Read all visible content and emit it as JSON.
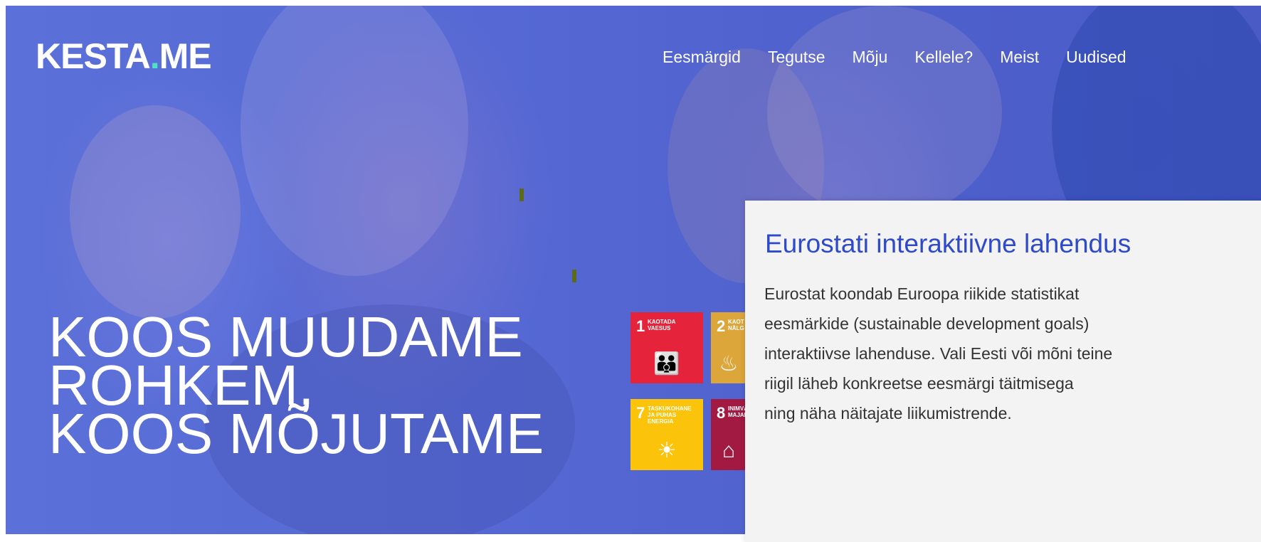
{
  "header": {
    "logo_text": "KESTA",
    "logo_dot": ".",
    "logo_suffix": "ME",
    "nav": [
      "Eesmärgid",
      "Tegutse",
      "Mõju",
      "Kellele?",
      "Meist",
      "Uudised"
    ]
  },
  "hero": {
    "headline_lines": [
      "KOOS MUUDAME",
      "ROHKEM,",
      "KOOS MÕJUTAME"
    ]
  },
  "sdg_tiles": [
    {
      "num": "1",
      "label": "KAOTADA VAESUS",
      "icon": "family-icon",
      "color": "#e5243b"
    },
    {
      "num": "2",
      "label": "KAOT NÄLG",
      "icon": "bowl-icon",
      "color": "#dda63a"
    },
    {
      "num": "7",
      "label": "TASKUKOHANE JA PUHAS ENERGIA",
      "icon": "sun-power-icon",
      "color": "#fcc30b"
    },
    {
      "num": "8",
      "label": "INIMVÄ MAJAND",
      "icon": "growth-icon",
      "color": "#a21942"
    }
  ],
  "card": {
    "title": "Eurostati interaktiivne lahendus",
    "body": "Eurostat koondab Euroopa riikide statistikat\neesmärkide (sustainable development goals)\ninteraktiivse lahenduse. Vali Eesti või mõni teine\nriigil läheb konkreetse eesmärgi täitmisega\nning näha näitajate liikumistrende."
  },
  "colors": {
    "accent": "#2f4ac8",
    "logo_dot": "#4ce3c4",
    "hero_overlay": "#5568d4"
  }
}
